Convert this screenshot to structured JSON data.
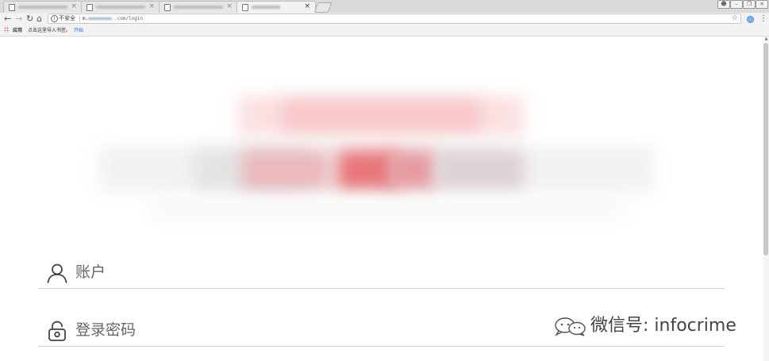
{
  "browser": {
    "tabs": [
      {
        "title": "",
        "active": false
      },
      {
        "title": "",
        "active": false
      },
      {
        "title": "",
        "active": false
      },
      {
        "title": "",
        "active": true
      }
    ],
    "tab_close_glyph": "×",
    "new_tab_icon": "new-tab-icon",
    "window_buttons": [
      "user-icon",
      "minimize-icon",
      "restore-icon",
      "close-icon"
    ],
    "nav_icons": [
      "back-icon",
      "forward-icon",
      "reload-icon",
      "home-icon"
    ],
    "omnibox": {
      "security_label": "不安全",
      "url_prefix": "m.",
      "url_suffix": ".com/login"
    },
    "bookmarks": {
      "apps_label": "应用",
      "import_prompt": "点击这里导入书签。",
      "start_link": "开始"
    }
  },
  "login": {
    "account_label": "账户",
    "account_icon": "user-icon",
    "password_label": "登录密码",
    "password_icon": "unlock-icon"
  },
  "watermark": {
    "icon": "wechat-icon",
    "text": "微信号: infocrime"
  },
  "colors": {
    "banner_red": "#e8757a",
    "banner_pink": "#f7c7c9",
    "link_blue": "#1a73e8",
    "label_gray": "#666666",
    "divider": "#d4d4d4"
  }
}
